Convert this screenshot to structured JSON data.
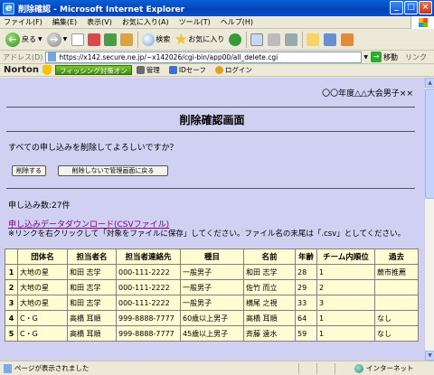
{
  "window": {
    "title": "削除確認 - Microsoft Internet Explorer"
  },
  "menu": [
    "ファイル(F)",
    "編集(E)",
    "表示(V)",
    "お気に入り(A)",
    "ツール(T)",
    "ヘルプ(H)"
  ],
  "toolbar": {
    "back": "戻る",
    "search": "検索",
    "favorites": "お気に入り"
  },
  "address": {
    "label": "アドレス(D)",
    "url": "https://x142.secure.ne.jp/~x142026/cgi-bin/app00/all_delete.cgi",
    "go": "移動",
    "links": "リンク"
  },
  "norton": {
    "brand": "Norton",
    "phishing": "フィッシング対策オン",
    "manage": "管理",
    "idsafe": "IDセーフ",
    "login": "ログイン"
  },
  "page": {
    "event_name": "〇〇年度△△大会男子××",
    "title": "削除確認画面",
    "question": "すべての申し込みを削除してよろしいですか？",
    "delete_button": "削除する",
    "back_button": "削除しないで管理画面に戻る",
    "count_text": "申し込み数:27件",
    "download_link": "申し込みデータダウンロード(CSVファイル)",
    "note": "※リンクを右クリックして「対象をファイルに保存」してください。ファイル名の末尾は「.csv」としてください。"
  },
  "table": {
    "headers": [
      "",
      "団体名",
      "担当者名",
      "担当者連絡先",
      "種目",
      "名前",
      "年齢",
      "チーム内順位",
      "過去"
    ],
    "rows": [
      [
        "1",
        "大地の星",
        "和田 志学",
        "000-111-2222",
        "一般男子",
        "和田 志学",
        "28",
        "1",
        "蕨市推薦"
      ],
      [
        "2",
        "大地の星",
        "和田 志学",
        "000-111-2222",
        "一般男子",
        "佐竹 而立",
        "29",
        "2",
        ""
      ],
      [
        "3",
        "大地の星",
        "和田 志学",
        "000-111-2222",
        "一般男子",
        "横尾 之視",
        "33",
        "3",
        ""
      ],
      [
        "4",
        "C・G",
        "高橋 耳順",
        "999-8888-7777",
        "60歳以上男子",
        "高橋 耳順",
        "64",
        "1",
        "なし"
      ],
      [
        "5",
        "C・G",
        "高橋 耳順",
        "999-8888-7777",
        "45歳以上男子",
        "斉藤 遠水",
        "59",
        "1",
        "なし"
      ]
    ]
  },
  "status": {
    "text": "ページが表示されました",
    "zone": "インターネット"
  }
}
